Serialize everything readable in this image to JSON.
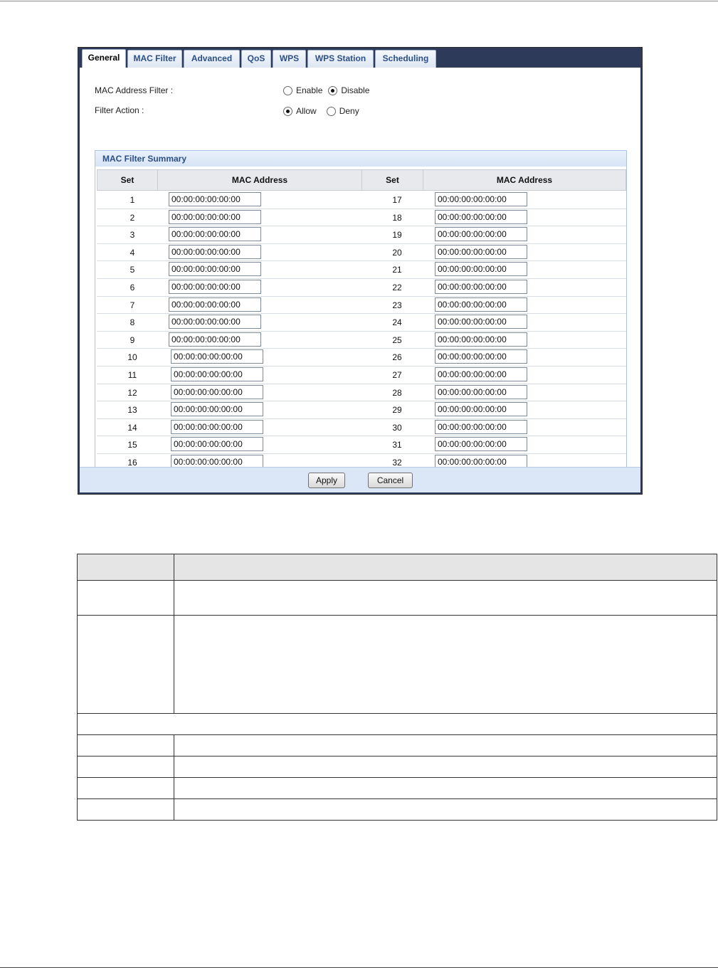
{
  "tabs": [
    "General",
    "MAC Filter",
    "Advanced",
    "QoS",
    "WPS",
    "WPS Station",
    "Scheduling"
  ],
  "active_tab_index": 1,
  "mac_address_filter": {
    "label": "MAC Address Filter :",
    "options": [
      "Enable",
      "Disable"
    ],
    "selected": "Disable"
  },
  "filter_action": {
    "label": "Filter Action :",
    "options": [
      "Allow",
      "Deny"
    ],
    "selected": "Allow"
  },
  "summary": {
    "title": "MAC Filter Summary",
    "headers": [
      "Set",
      "MAC Address",
      "Set",
      "MAC Address"
    ],
    "left_sets": [
      "1",
      "2",
      "3",
      "4",
      "5",
      "6",
      "7",
      "8",
      "9",
      "10",
      "11",
      "12",
      "13",
      "14",
      "15",
      "16"
    ],
    "right_sets": [
      "17",
      "18",
      "19",
      "20",
      "21",
      "22",
      "23",
      "24",
      "25",
      "26",
      "27",
      "28",
      "29",
      "30",
      "31",
      "32"
    ],
    "left_macs": [
      "00:00:00:00:00:00",
      "00:00:00:00:00:00",
      "00:00:00:00:00:00",
      "00:00:00:00:00:00",
      "00:00:00:00:00:00",
      "00:00:00:00:00:00",
      "00:00:00:00:00:00",
      "00:00:00:00:00:00",
      "00:00:00:00:00:00",
      "00:00:00:00:00:00",
      "00:00:00:00:00:00",
      "00:00:00:00:00:00",
      "00:00:00:00:00:00",
      "00:00:00:00:00:00",
      "00:00:00:00:00:00",
      "00:00:00:00:00:00"
    ],
    "right_macs": [
      "00:00:00:00:00:00",
      "00:00:00:00:00:00",
      "00:00:00:00:00:00",
      "00:00:00:00:00:00",
      "00:00:00:00:00:00",
      "00:00:00:00:00:00",
      "00:00:00:00:00:00",
      "00:00:00:00:00:00",
      "00:00:00:00:00:00",
      "00:00:00:00:00:00",
      "00:00:00:00:00:00",
      "00:00:00:00:00:00",
      "00:00:00:00:00:00",
      "00:00:00:00:00:00",
      "00:00:00:00:00:00",
      "00:00:00:00:00:00"
    ]
  },
  "buttons": {
    "apply": "Apply",
    "cancel": "Cancel"
  },
  "colors": {
    "tab_bar": "#2e3a59",
    "footer": "#dbe7f6",
    "summary_border": "#a9c3e4",
    "tab_text": "#2c4f86"
  }
}
